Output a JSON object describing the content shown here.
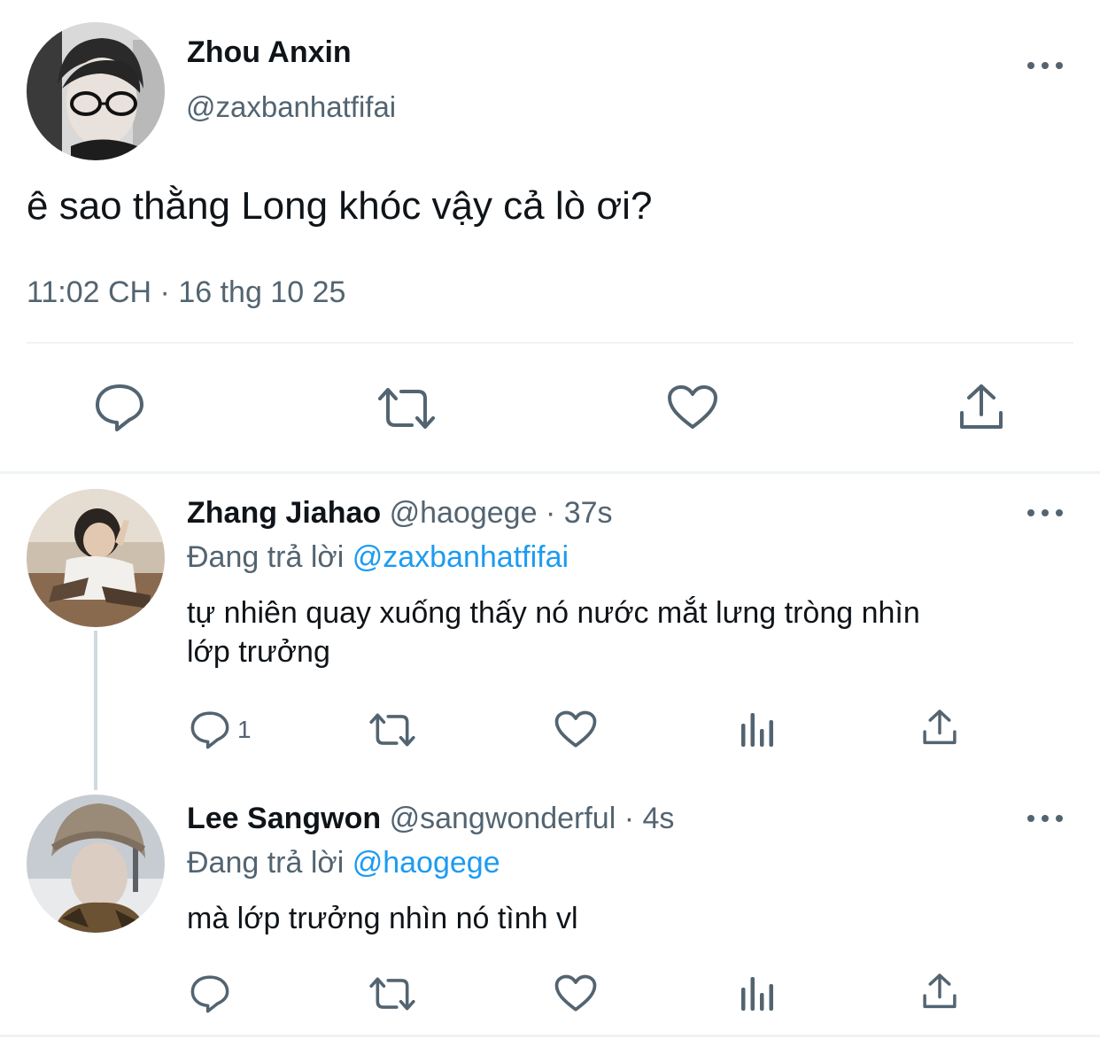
{
  "main_tweet": {
    "author_name": "Zhou Anxin",
    "handle": "@zaxbanhatfifai",
    "text": "ê sao thằng Long khóc vậy cả lò ơi?",
    "timestamp": "11:02 CH · 16 thg 10 25",
    "actions": [
      "reply-icon",
      "retweet-icon",
      "like-icon",
      "share-icon"
    ]
  },
  "replies": [
    {
      "author_name": "Zhang Jiahao",
      "handle": "@haogege",
      "separator": "·",
      "time": "37s",
      "replying_prefix": "Đang trả lời",
      "replying_to": "@zaxbanhatfifai",
      "text_line1": "tự nhiên quay xuống thấy nó nước mắt lưng tròng nhìn",
      "text_line2": "lớp trưởng",
      "reply_count": "1"
    },
    {
      "author_name": "Lee Sangwon",
      "handle": "@sangwonderful",
      "separator": "·",
      "time": "4s",
      "replying_prefix": "Đang trả lời",
      "replying_to": "@haogege",
      "text_line1": "mà lớp trưởng nhìn nó tình vl",
      "reply_count": ""
    }
  ],
  "colors": {
    "text": "#0f1419",
    "muted": "#536471",
    "link": "#1d9bf0",
    "divider": "#eff3f4",
    "thread_line": "#cfd9de"
  }
}
